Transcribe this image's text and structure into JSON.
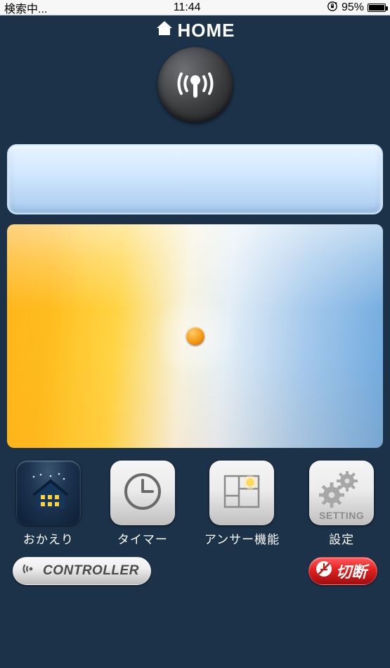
{
  "status": {
    "left": "検索中...",
    "time": "11:44",
    "battery": "95%"
  },
  "header": {
    "title": "HOME"
  },
  "buttons": {
    "okaeri": {
      "label": "おかえり"
    },
    "timer": {
      "label": "タイマー"
    },
    "answer": {
      "label": "アンサー機能"
    },
    "setting": {
      "label": "設定",
      "tile_text": "SETTING"
    }
  },
  "bottom": {
    "controller": "CONTROLLER",
    "disconnect": "切断"
  },
  "colors": {
    "bg": "#1b3249",
    "accent_orange": "#f59a12",
    "accent_blue": "#6fa9de"
  }
}
